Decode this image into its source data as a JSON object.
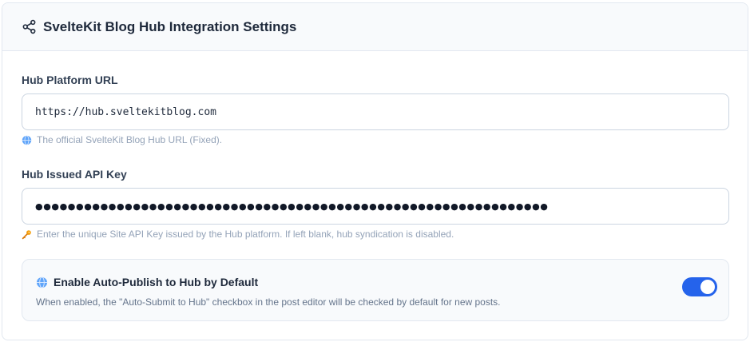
{
  "header": {
    "title": "SvelteKit Blog Hub Integration Settings",
    "icon": "share-icon"
  },
  "hub_url": {
    "label": "Hub Platform URL",
    "value": "https://hub.sveltekitblog.com",
    "hint_icon": "globe-icon",
    "hint": "The official SvelteKit Blog Hub URL (Fixed)."
  },
  "api_key": {
    "label": "Hub Issued API Key",
    "value_masked": "●●●●●●●●●●●●●●●●●●●●●●●●●●●●●●●●●●●●●●●●●●●●●●●●●●●●●●●●●●●●●●●",
    "hint_icon": "key-icon",
    "hint": "Enter the unique Site API Key issued by the Hub platform. If left blank, hub syndication is disabled."
  },
  "auto_publish": {
    "icon": "globe-icon",
    "title": "Enable Auto-Publish to Hub by Default",
    "description": "When enabled, the \"Auto-Submit to Hub\" checkbox in the post editor will be checked by default for new posts.",
    "enabled": true
  },
  "colors": {
    "accent": "#2563eb",
    "border": "#e2e8f0",
    "header_bg": "#f8fafc"
  }
}
